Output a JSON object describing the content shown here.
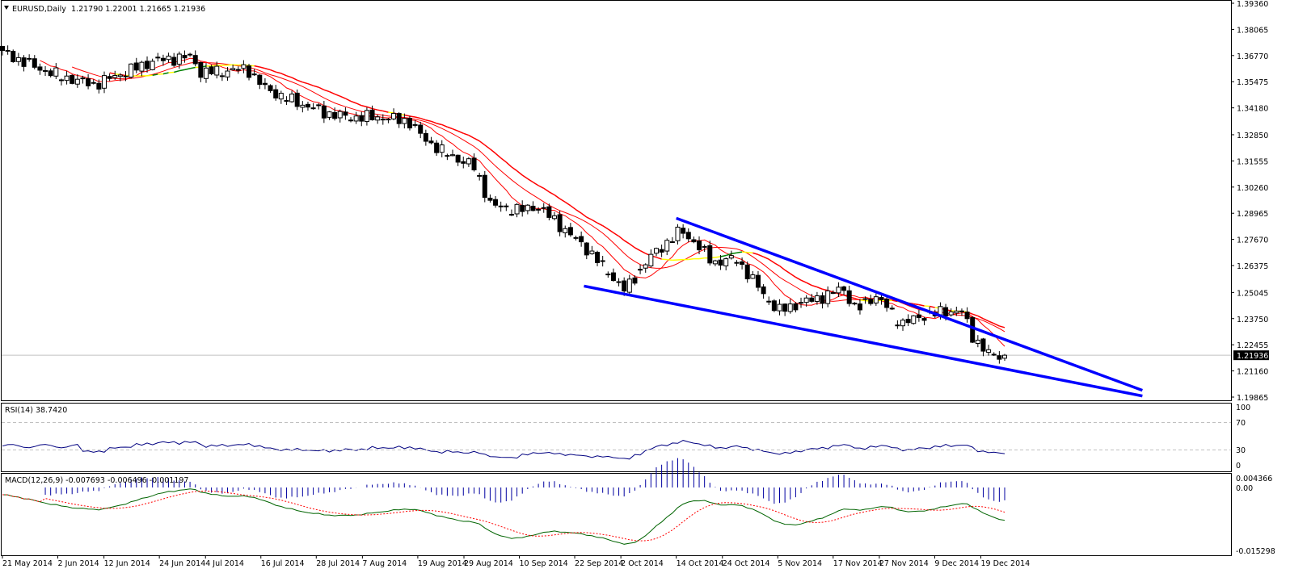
{
  "header": {
    "symbol_label": "EURUSD,Daily",
    "ohlc_label": "1.21790 1.22001 1.21665 1.21936",
    "menu_icon": "triangle-down-icon"
  },
  "rsi": {
    "label": "RSI(14) 38.7420",
    "levels": [
      "100",
      "70",
      "30",
      "0"
    ]
  },
  "macd": {
    "label": "MACD(12,26,9) -0.007693 -0.006496 -0.001197",
    "scale": [
      "0.004366",
      "0.00",
      "-0.015298"
    ]
  },
  "chart_data": {
    "type": "candlestick",
    "symbol": "EURUSD",
    "timeframe": "Daily",
    "last_bar": {
      "open": 1.2179,
      "high": 1.22001,
      "low": 1.21665,
      "close": 1.21936
    },
    "current_price_label": "1.21936",
    "y_ticks": [
      "1.39360",
      "1.38065",
      "1.36770",
      "1.35475",
      "1.34180",
      "1.32850",
      "1.31555",
      "1.30260",
      "1.28965",
      "1.27670",
      "1.26375",
      "1.25045",
      "1.23750",
      "1.22455",
      "1.21160",
      "1.19865"
    ],
    "ylim": [
      1.19865,
      1.3936
    ],
    "x_ticks": [
      "21 May 2014",
      "2 Jun 2014",
      "12 Jun 2014",
      "24 Jun 2014",
      "4 Jul 2014",
      "16 Jul 2014",
      "28 Jul 2014",
      "7 Aug 2014",
      "19 Aug 2014",
      "29 Aug 2014",
      "10 Sep 2014",
      "22 Sep 2014",
      "2 Oct 2014",
      "14 Oct 2014",
      "24 Oct 2014",
      "5 Nov 2014",
      "17 Nov 2014",
      "27 Nov 2014",
      "9 Dec 2014",
      "19 Dec 2014"
    ],
    "close_path": [
      [
        "2014-05-21",
        1.3692
      ],
      [
        "2014-05-29",
        1.3612
      ],
      [
        "2014-06-03",
        1.3572
      ],
      [
        "2014-06-10",
        1.3532
      ],
      [
        "2014-06-14",
        1.3572
      ],
      [
        "2014-06-23",
        1.3652
      ],
      [
        "2014-07-01",
        1.3672
      ],
      [
        "2014-07-03",
        1.3592
      ],
      [
        "2014-07-13",
        1.3612
      ],
      [
        "2014-07-17",
        1.3512
      ],
      [
        "2014-07-23",
        1.3452
      ],
      [
        "2014-07-30",
        1.3392
      ],
      [
        "2014-08-04",
        1.3372
      ],
      [
        "2014-08-11",
        1.3372
      ],
      [
        "2014-08-17",
        1.3352
      ],
      [
        "2014-08-20",
        1.3272
      ],
      [
        "2014-08-25",
        1.3192
      ],
      [
        "2014-08-31",
        1.3132
      ],
      [
        "2014-09-04",
        1.2932
      ],
      [
        "2014-09-11",
        1.2912
      ],
      [
        "2014-09-14",
        1.2932
      ],
      [
        "2014-09-20",
        1.2812
      ],
      [
        "2014-09-25",
        1.2712
      ],
      [
        "2014-09-29",
        1.2612
      ],
      [
        "2014-10-03",
        1.2512
      ],
      [
        "2014-10-08",
        1.2672
      ],
      [
        "2014-10-12",
        1.2752
      ],
      [
        "2014-10-15",
        1.2812
      ],
      [
        "2014-10-18",
        1.2752
      ],
      [
        "2014-10-22",
        1.2652
      ],
      [
        "2014-10-27",
        1.2672
      ],
      [
        "2014-10-31",
        1.2552
      ],
      [
        "2014-11-05",
        1.2412
      ],
      [
        "2014-11-10",
        1.2452
      ],
      [
        "2014-11-16",
        1.2492
      ],
      [
        "2014-11-19",
        1.2532
      ],
      [
        "2014-11-22",
        1.2412
      ],
      [
        "2014-11-26",
        1.2492
      ],
      [
        "2014-12-02",
        1.2352
      ],
      [
        "2014-12-07",
        1.2392
      ],
      [
        "2014-12-12",
        1.2412
      ],
      [
        "2014-12-15",
        1.2412
      ],
      [
        "2014-12-17",
        1.2292
      ],
      [
        "2014-12-21",
        1.2192
      ],
      [
        "2014-12-26",
        1.2194
      ]
    ],
    "trendlines": [
      {
        "from": [
          "2014-10-14",
          1.2872
        ],
        "to": [
          "2015-01-23",
          1.202
        ],
        "color": "#0000ff"
      },
      {
        "from": [
          "2014-09-24",
          1.2536
        ],
        "to": [
          "2015-01-23",
          1.1992
        ],
        "color": "#0000ff"
      }
    ],
    "colors": {
      "bull": "#ffffff",
      "bear": "#000000",
      "ma": "#ff0000",
      "rsi": "#000080",
      "macd_main": "#006400",
      "macd_signal": "#ff0000",
      "macd_hist": "#0000a0",
      "trendline": "#0000ff"
    },
    "grid": false
  }
}
